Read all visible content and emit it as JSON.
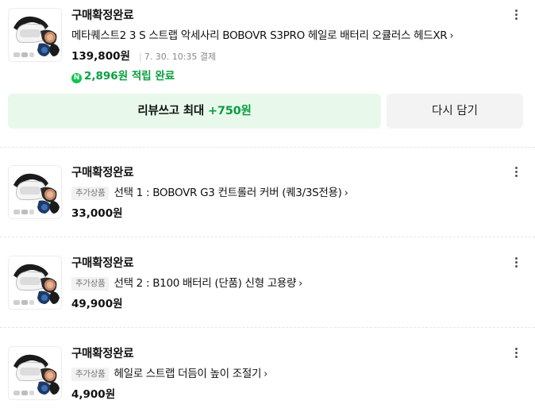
{
  "orders": [
    {
      "status": "구매확정완료",
      "title": "메타퀘스트2 3 S 스트랩 악세사리 BOBOVR S3PRO 헤일로 배터리 오큘러스 헤드XR",
      "price": "139,800원",
      "pay_info": "7. 30. 10:35 결제",
      "point_badge": "N",
      "points": "2,896원 적립 완료"
    },
    {
      "status": "구매확정완료",
      "tag": "추가상품",
      "title": "선택 1 : BOBOVR G3 컨트롤러 커버 (퀘3/3S전용)",
      "price": "33,000원"
    },
    {
      "status": "구매확정완료",
      "tag": "추가상품",
      "title": "선택 2 : B100 배터리 (단품) 신형 고용량",
      "price": "49,900원"
    },
    {
      "status": "구매확정완료",
      "tag": "추가상품",
      "title": "헤일로 스트랩 더듬이 높이 조절기",
      "price": "4,900원"
    }
  ],
  "actions": {
    "review_label": "리뷰쓰고 최대",
    "review_bonus": "+750원",
    "recart_label": "다시 담기"
  },
  "icons": {
    "more": "more-vertical-icon",
    "chevron": "chevron-right-icon",
    "point": "naverpay-point-icon"
  },
  "colors": {
    "accent_green": "#0a9e3f",
    "review_button_bg": "#e8f9ec",
    "secondary_button_bg": "#f3f3f3"
  }
}
